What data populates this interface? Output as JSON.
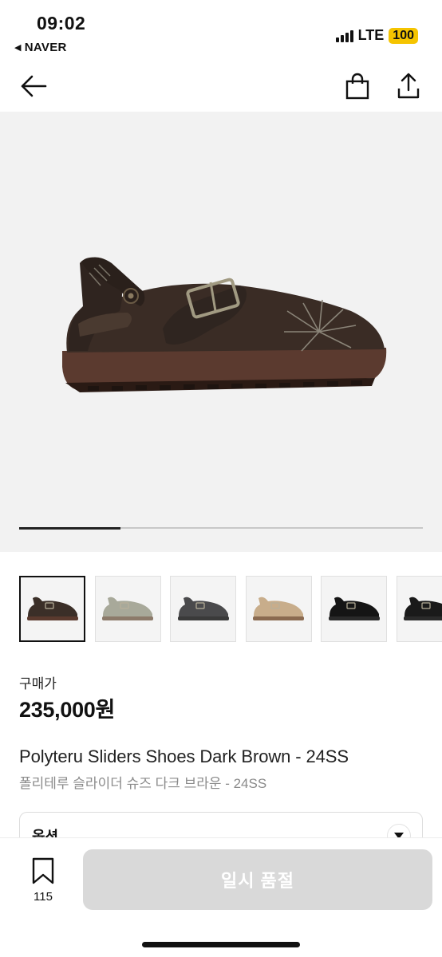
{
  "status_bar": {
    "time": "09:02",
    "back_app": "NAVER",
    "network": "LTE",
    "battery": "100"
  },
  "header": {
    "back_icon": "arrow-left-icon",
    "bag_icon": "shopping-bag-icon",
    "share_icon": "share-icon"
  },
  "gallery": {
    "progress": 0.25,
    "thumbnails": [
      {
        "color": "dark brown",
        "shoe_color": "#3b2f28",
        "sole": "#5a3a2e",
        "active": true
      },
      {
        "color": "grey",
        "shoe_color": "#a8a99a",
        "sole": "#8c7a6a",
        "active": false
      },
      {
        "color": "charcoal",
        "shoe_color": "#4a4a4c",
        "sole": "#3a3a3a",
        "active": false
      },
      {
        "color": "beige",
        "shoe_color": "#c8ad8b",
        "sole": "#8a6a50",
        "active": false
      },
      {
        "color": "black",
        "shoe_color": "#151515",
        "sole": "#2a2a2a",
        "active": false
      },
      {
        "color": "black",
        "shoe_color": "#1a1a1a",
        "sole": "#2a2a2a",
        "active": false
      }
    ]
  },
  "product": {
    "price_label": "구매가",
    "price": "235,000원",
    "title_en": "Polyteru Sliders Shoes Dark Brown - 24SS",
    "title_ko": "폴리테루 슬라이더 슈즈 다크 브라운 - 24SS",
    "option_label": "옵션"
  },
  "bottom": {
    "wish_count": "115",
    "cta_label": "일시 품절"
  }
}
